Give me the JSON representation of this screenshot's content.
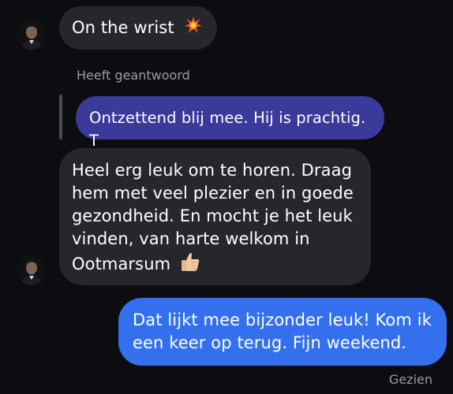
{
  "messages": [
    {
      "sender": "contact",
      "text": "On the wrist",
      "emoji": "collision-emoji"
    },
    {
      "reply_label": "Heeft geantwoord",
      "replied_text": "Ontzettend blij mee. Hij is prachtig. T"
    },
    {
      "sender": "contact",
      "lines": [
        "Heel erg leuk om te horen. Draag",
        "hem met veel plezier en in goede",
        "gezondheid. En mocht je het leuk",
        "vinden, van harte welkom in",
        "Ootmarsum"
      ],
      "emoji": "thumbs-up-emoji"
    },
    {
      "sender": "me",
      "lines": [
        "Dat lijkt mee bijzonder leuk! Kom ik",
        "een keer op terug. Fijn weekend."
      ]
    }
  ],
  "status": "Gezien",
  "colors": {
    "background": "#0c0d10",
    "incoming_bubble": "#26272b",
    "outgoing_bubble": "#3470ee",
    "replied_bubble": "#3b3a9a"
  }
}
